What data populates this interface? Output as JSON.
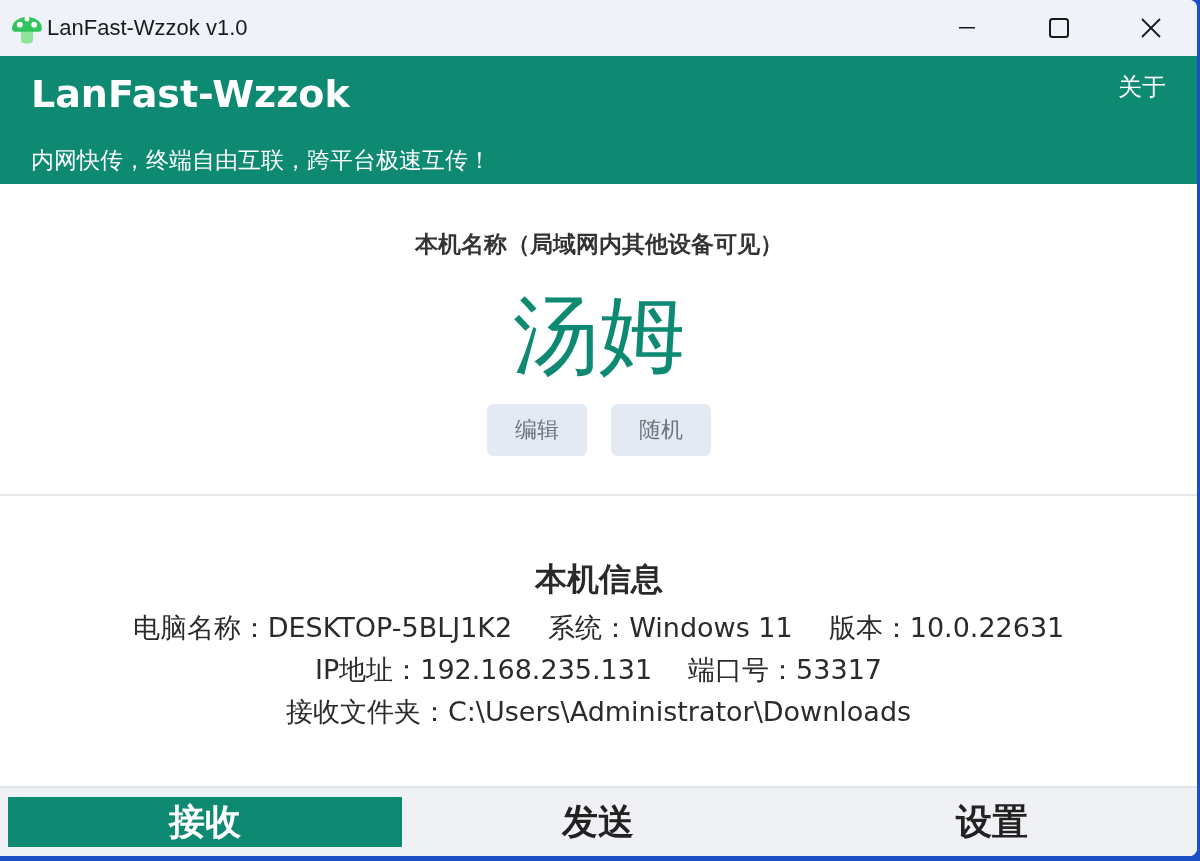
{
  "window": {
    "title": "LanFast-Wzzok v1.0"
  },
  "header": {
    "title": "LanFast-Wzzok",
    "subtitle": "内网快传，终端自由互联，跨平台极速互传！",
    "about": "关于"
  },
  "device_name": {
    "label": "本机名称（局域网内其他设备可见）",
    "value": "汤姆",
    "buttons": [
      "编辑",
      "随机"
    ]
  },
  "info": {
    "title": "本机信息",
    "lines": [
      [
        "电脑名称：DESKTOP-5BLJ1K2",
        "系统：Windows 11",
        "版本：10.0.22631"
      ],
      [
        "IP地址：192.168.235.131",
        "端口号：53317"
      ],
      [
        "接收文件夹：C:\\Users\\Administrator\\Downloads"
      ]
    ]
  },
  "tabs": [
    {
      "label": "接收",
      "selected": true
    },
    {
      "label": "发送",
      "selected": false
    },
    {
      "label": "设置",
      "selected": false
    }
  ]
}
